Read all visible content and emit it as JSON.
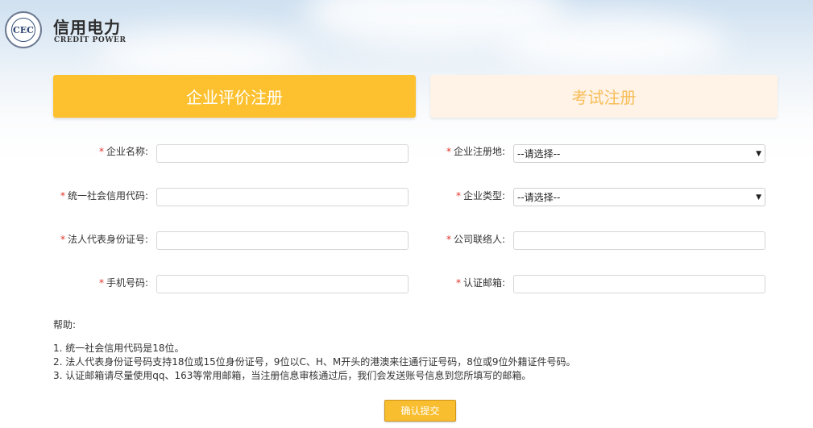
{
  "header": {
    "brand_cn": "信用电力",
    "brand_en": "CREDIT POWER",
    "logo_text": "CEC"
  },
  "tabs": [
    {
      "label": "企业评价注册",
      "active": true
    },
    {
      "label": "考试注册",
      "active": false
    }
  ],
  "form": {
    "required_mark": "*",
    "company_name_label": "企业名称:",
    "credit_code_label": "统一社会信用代码:",
    "legal_id_label": "法人代表身份证号:",
    "phone_label": "手机号码:",
    "reg_place_label": "企业注册地:",
    "reg_place_value": "--请选择--",
    "company_type_label": "企业类型:",
    "company_type_value": "--请选择--",
    "contact_label": "公司联络人:",
    "email_label": "认证邮箱:"
  },
  "help": {
    "title": "帮助:",
    "lines": [
      "1. 统一社会信用代码是18位。",
      "2. 法人代表身份证号码支持18位或15位身份证号，9位以C、H、M开头的港澳来往通行证号码，8位或9位外籍证件号码。",
      "3. 认证邮箱请尽量使用qq、163等常用邮箱，当注册信息审核通过后，我们会发送账号信息到您所填写的邮箱。"
    ]
  },
  "submit_label": "确认提交",
  "colors": {
    "accent": "#fdc12f",
    "tab_inactive_bg": "#fef3e6",
    "tab_inactive_text": "#f7bd59",
    "required": "#e2322a"
  }
}
